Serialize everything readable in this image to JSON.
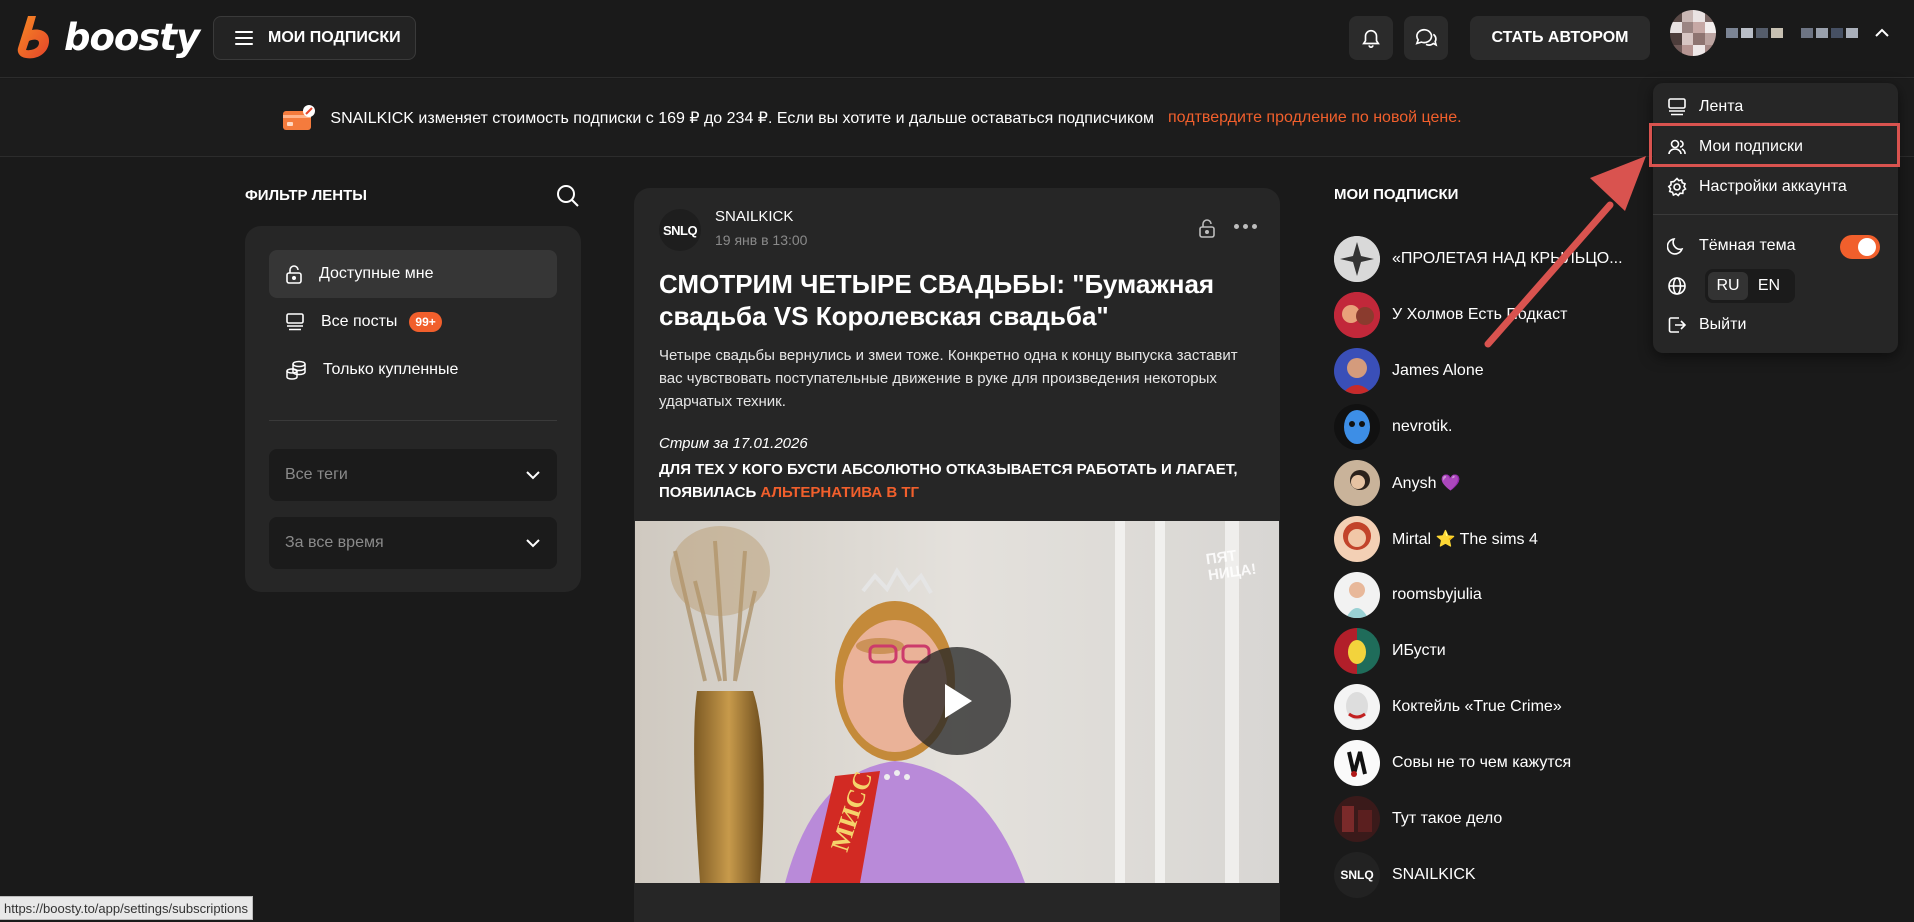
{
  "header": {
    "logo_text": "boosty",
    "subs_button_label": "МОИ ПОДПИСКИ",
    "become_author_label": "СТАТЬ АВТОРОМ"
  },
  "banner": {
    "text": "SNAILKICK изменяет стоимость подписки с 169 ₽ до 234 ₽. Если вы хотите и дальше оставаться подписчиком",
    "link": "подтвердите продление по новой цене."
  },
  "filter": {
    "title": "ФИЛЬТР ЛЕНТЫ",
    "items": [
      {
        "label": "Доступные мне"
      },
      {
        "label": "Все посты",
        "badge": "99+"
      },
      {
        "label": "Только купленные"
      }
    ],
    "tags_placeholder": "Все теги",
    "period_placeholder": "За все время"
  },
  "post": {
    "avatar_text": "SNLQ",
    "author": "SNAILKICK",
    "date": "19 янв в 13:00",
    "title": "СМОТРИМ ЧЕТЫРЕ СВАДЬБЫ: \"Бумажная свадьба VS Королевская свадьба\"",
    "text": "Четыре свадьбы вернулись и змеи тоже. Конкретно одна к концу выпуска заставит вас чувствовать поступательные движение в руке для произведения некоторых ударчатых техник.",
    "stream": "Стрим за 17.01.2026",
    "bold_text": "ДЛЯ ТЕХ У КОГО БУСТИ АБСОЛЮТНО ОТКАЗЫВАЕТСЯ РАБОТАТЬ И ЛАГАЕТ, ПОЯВИЛАСЬ ",
    "bold_link": "АЛЬТЕРНАТИВА В ТГ",
    "watermark_line1": "ПЯТ",
    "watermark_line2": "НИЦА!",
    "sash_text": "МИСС"
  },
  "subscriptions": {
    "title": "МОИ ПОДПИСКИ",
    "items": [
      {
        "name": "«ПРОЛЕТАЯ НАД КРЫЛЬЦО..."
      },
      {
        "name": "У Холмов Есть Подкаст"
      },
      {
        "name": "James Alone"
      },
      {
        "name": "nevrotik."
      },
      {
        "name": "Anysh 💜"
      },
      {
        "name": "Mirtal ⭐ The sims 4"
      },
      {
        "name": "roomsbyjulia"
      },
      {
        "name": "ИБусти"
      },
      {
        "name": "Коктейль «True Crime»"
      },
      {
        "name": "Совы не то чем кажутся"
      },
      {
        "name": "Тут такое дело"
      },
      {
        "name": "SNAILKICK",
        "avatar_text": "SNLQ"
      }
    ]
  },
  "dropdown": {
    "items": [
      {
        "label": "Лента"
      },
      {
        "label": "Мои подписки"
      },
      {
        "label": "Настройки аккаунта"
      }
    ],
    "dark_theme_label": "Тёмная тема",
    "lang_ru": "RU",
    "lang_en": "EN",
    "logout_label": "Выйти"
  },
  "status_bar": {
    "url": "https://boosty.to/app/settings/subscriptions"
  },
  "colors": {
    "accent": "#f15f2c",
    "background": "#1a1a1a",
    "card": "#262626",
    "annotation_red": "#d9534f"
  }
}
